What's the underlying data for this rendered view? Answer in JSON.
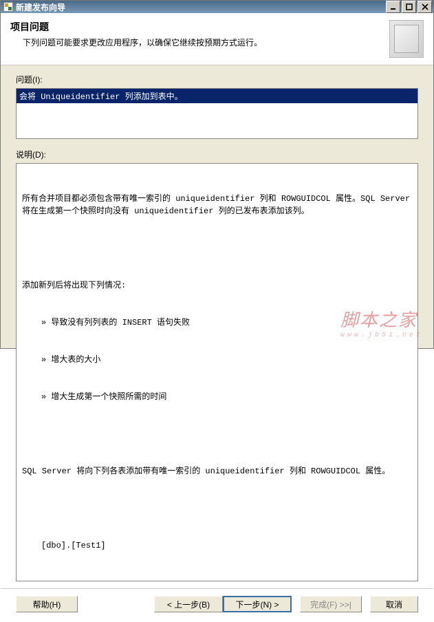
{
  "window": {
    "title": "新建发布向导"
  },
  "header": {
    "title": "项目问题",
    "subtitle": "下列问题可能要求更改应用程序，以确保它继续按预期方式运行。"
  },
  "labels": {
    "issues": "问题(I):",
    "description": "说明(D):"
  },
  "issues": {
    "selected": "会将 Uniqueidentifier 列添加到表中。"
  },
  "description": {
    "line1": "所有合并项目都必须包含带有唯一索引的 uniqueidentifier 列和 ROWGUIDCOL 属性。SQL Server 将在生成第一个快照时向没有 uniqueidentifier 列的已发布表添加该列。",
    "line2": "添加新列后将出现下列情况:",
    "b1": "导致没有列列表的 INSERT 语句失败",
    "b2": "增大表的大小",
    "b3": "增大生成第一个快照所需的时间",
    "line3": "SQL Server 将向下列各表添加带有唯一索引的 uniqueidentifier 列和 ROWGUIDCOL 属性。",
    "table": "[dbo].[Test1]"
  },
  "buttons": {
    "help": "帮助(H)",
    "back": "< 上一步(B)",
    "next": "下一步(N) >",
    "finish": "完成(F) >>|",
    "cancel": "取消"
  },
  "watermark": {
    "text": "脚本之家",
    "url": "www.jb51.net"
  }
}
